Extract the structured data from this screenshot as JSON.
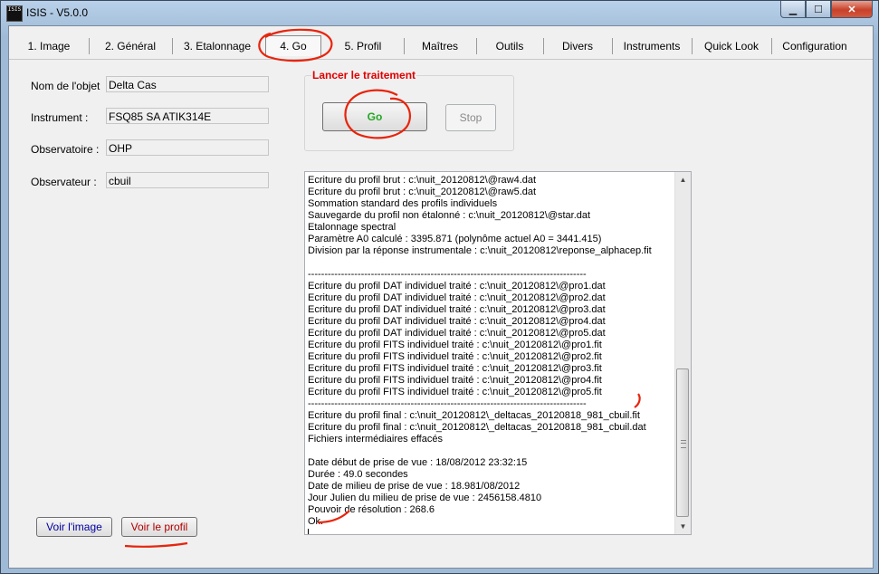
{
  "window": {
    "title": "ISIS - V5.0.0",
    "app_icon_text": "ISIS",
    "buttons": {
      "minimize": "▁",
      "maximize": "☐",
      "close": "✕"
    }
  },
  "tabs": [
    {
      "label": "1. Image"
    },
    {
      "label": "2. Général"
    },
    {
      "label": "3. Etalonnage"
    },
    {
      "label": "4. Go"
    },
    {
      "label": "5. Profil"
    },
    {
      "label": "Maîtres"
    },
    {
      "label": "Outils"
    },
    {
      "label": "Divers"
    },
    {
      "label": "Instruments"
    },
    {
      "label": "Quick Look"
    },
    {
      "label": "Configuration"
    }
  ],
  "active_tab": "4. Go",
  "form": {
    "object_label": "Nom de l'objet",
    "object_value": "Delta Cas",
    "instrument_label": "Instrument :",
    "instrument_value": "FSQ85 SA ATIK314E",
    "observatory_label": "Observatoire :",
    "observatory_value": "OHP",
    "observer_label": "Observateur :",
    "observer_value": "cbuil"
  },
  "launch": {
    "group_title": "Lancer le traitement",
    "go_label": "Go",
    "stop_label": "Stop"
  },
  "buttons": {
    "view_image": "Voir l'image",
    "view_profile": "Voir le profil"
  },
  "log": [
    "Ecriture du profil brut : c:\\nuit_20120812\\@raw4.dat",
    "Ecriture du profil brut : c:\\nuit_20120812\\@raw5.dat",
    "Sommation standard des profils individuels",
    "Sauvegarde du profil non étalonné : c:\\nuit_20120812\\@star.dat",
    "Etalonnage spectral",
    "Paramètre A0 calculé : 3395.871 (polynôme actuel A0 = 3441.415)",
    "Division par la réponse instrumentale : c:\\nuit_20120812\\reponse_alphacep.fit",
    "",
    "------------------------------------------------------------------------------------",
    "Ecriture du profil DAT individuel traité : c:\\nuit_20120812\\@pro1.dat",
    "Ecriture du profil DAT individuel traité : c:\\nuit_20120812\\@pro2.dat",
    "Ecriture du profil DAT individuel traité : c:\\nuit_20120812\\@pro3.dat",
    "Ecriture du profil DAT individuel traité : c:\\nuit_20120812\\@pro4.dat",
    "Ecriture du profil DAT individuel traité : c:\\nuit_20120812\\@pro5.dat",
    "Ecriture du profil FITS individuel traité : c:\\nuit_20120812\\@pro1.fit",
    "Ecriture du profil FITS individuel traité : c:\\nuit_20120812\\@pro2.fit",
    "Ecriture du profil FITS individuel traité : c:\\nuit_20120812\\@pro3.fit",
    "Ecriture du profil FITS individuel traité : c:\\nuit_20120812\\@pro4.fit",
    "Ecriture du profil FITS individuel traité : c:\\nuit_20120812\\@pro5.fit",
    "------------------------------------------------------------------------------------",
    "Ecriture du profil final : c:\\nuit_20120812\\_deltacas_20120818_981_cbuil.fit",
    "Ecriture du profil final : c:\\nuit_20120812\\_deltacas_20120818_981_cbuil.dat",
    "Fichiers intermédiaires effacés",
    "",
    "Date début de prise de vue : 18/08/2012 23:32:15",
    "Durée : 49.0 secondes",
    "Date de milieu de prise de vue : 18.981/08/2012",
    "Jour Julien du milieu de prise de vue : 2456158.4810",
    "Pouvoir de résolution : 268.6",
    "Ok."
  ],
  "colors": {
    "annotation_red": "#e8240c",
    "launch_title": "#e00000",
    "go_text": "#22a822",
    "view_image_text": "#0000a0",
    "view_profile_text": "#b00000"
  },
  "icons": {
    "scroll_up": "▲",
    "scroll_down": "▼"
  }
}
